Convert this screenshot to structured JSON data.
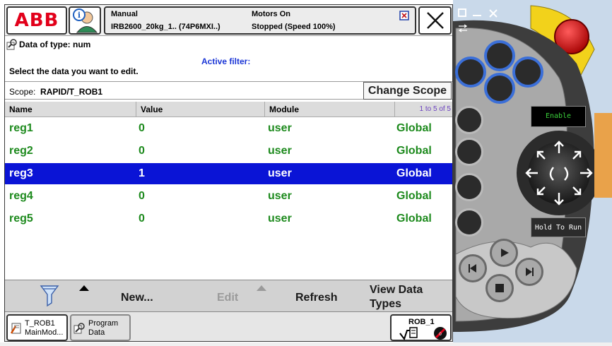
{
  "topbar": {
    "logo_text": "ABB",
    "mode": "Manual",
    "controller": "IRB2600_20kg_1.. (74P6MXI..)",
    "motors": "Motors On",
    "state": "Stopped (Speed 100%)"
  },
  "view": {
    "title": "Data of type: num",
    "active_filter_label": "Active filter:",
    "instruction": "Select the data you want to edit.",
    "scope_label": "Scope:",
    "scope_value": "RAPID/T_ROB1",
    "change_scope_label": "Change Scope"
  },
  "table": {
    "headers": [
      "Name",
      "Value",
      "Module"
    ],
    "page_indicator": "1 to 5 of 5",
    "rows": [
      {
        "name": "reg1",
        "value": "0",
        "module": "user",
        "scope": "Global",
        "selected": false
      },
      {
        "name": "reg2",
        "value": "0",
        "module": "user",
        "scope": "Global",
        "selected": false
      },
      {
        "name": "reg3",
        "value": "1",
        "module": "user",
        "scope": "Global",
        "selected": true
      },
      {
        "name": "reg4",
        "value": "0",
        "module": "user",
        "scope": "Global",
        "selected": false
      },
      {
        "name": "reg5",
        "value": "0",
        "module": "user",
        "scope": "Global",
        "selected": false
      }
    ]
  },
  "toolbar": {
    "new_label": "New...",
    "edit_label": "Edit",
    "refresh_label": "Refresh",
    "view_types_label": "View Data\nTypes"
  },
  "taskbar": {
    "task1_line1": "T_ROB1",
    "task1_line2": "MainMod...",
    "task2_line1": "Program",
    "task2_line2": "Data",
    "mech_unit": "ROB_1"
  },
  "pendant": {
    "enable_label": "Enable",
    "hold_label": "Hold To Run"
  },
  "colors": {
    "abb_red": "#e2001a",
    "selection_blue": "#0a14d6",
    "row_green": "#1d8a1d",
    "filter_blue": "#1a35d6",
    "pendant_button_blue": "#3b6fd8"
  }
}
